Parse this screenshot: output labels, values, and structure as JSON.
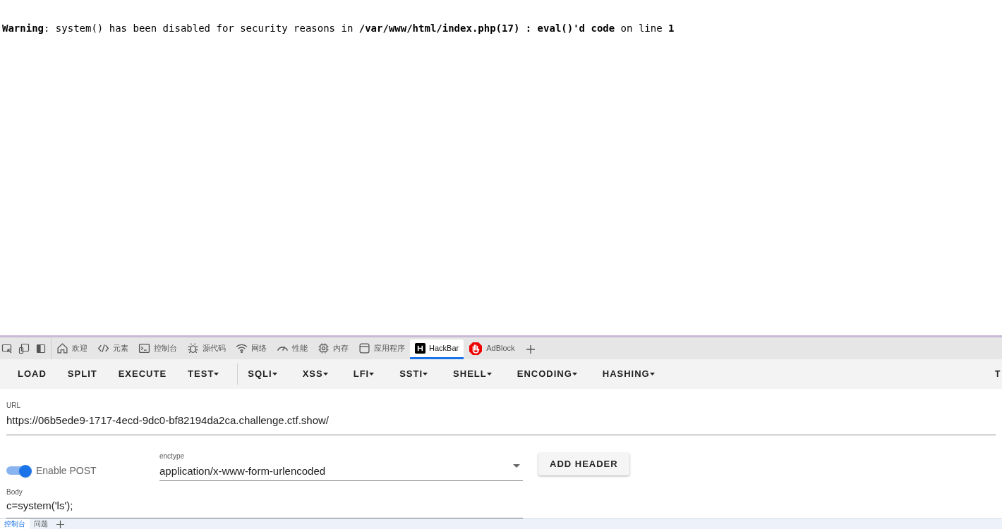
{
  "page": {
    "warning": "**Warning**: system() has been disabled for security reasons in **/var/www/html/index.php(17) : eval()'d code** on line **1**"
  },
  "devtools": {
    "tabs": [
      {
        "label": "欢迎",
        "selected": false
      },
      {
        "label": "元素",
        "selected": false
      },
      {
        "label": "控制台",
        "selected": false
      },
      {
        "label": "源代码",
        "selected": false
      },
      {
        "label": "网络",
        "selected": false
      },
      {
        "label": "性能",
        "selected": false
      },
      {
        "label": "内存",
        "selected": false
      },
      {
        "label": "应用程序",
        "selected": false
      },
      {
        "label": "HackBar",
        "selected": true
      },
      {
        "label": "AdBlock",
        "selected": false
      }
    ]
  },
  "hackbar": {
    "toolbar": [
      {
        "kind": "button",
        "label": "LOAD"
      },
      {
        "kind": "button",
        "label": "SPLIT"
      },
      {
        "kind": "button",
        "label": "EXECUTE"
      },
      {
        "kind": "menu",
        "label": "TEST"
      },
      {
        "kind": "separator"
      },
      {
        "kind": "menu",
        "label": "SQLI"
      },
      {
        "kind": "menu",
        "label": "XSS"
      },
      {
        "kind": "menu",
        "label": "LFI"
      },
      {
        "kind": "menu",
        "label": "SSTI"
      },
      {
        "kind": "menu",
        "label": "SHELL"
      },
      {
        "kind": "menu",
        "label": "ENCODING"
      },
      {
        "kind": "menu",
        "label": "HASHING"
      }
    ],
    "toolbar_cut": "T",
    "url": {
      "label": "URL",
      "value": "https://06b5ede9-1717-4ecd-9dc0-bf82194da2ca.challenge.ctf.show/"
    },
    "enable_post": {
      "label": "Enable POST",
      "on": true
    },
    "enctype": {
      "label": "enctype",
      "value": "application/x-www-form-urlencoded"
    },
    "add_header": "ADD HEADER",
    "body": {
      "label": "Body",
      "value": "c=system('ls');"
    }
  },
  "drawer": {
    "tabs": [
      {
        "label": "控制台",
        "selected": true
      },
      {
        "label": "问题",
        "selected": false
      }
    ]
  }
}
